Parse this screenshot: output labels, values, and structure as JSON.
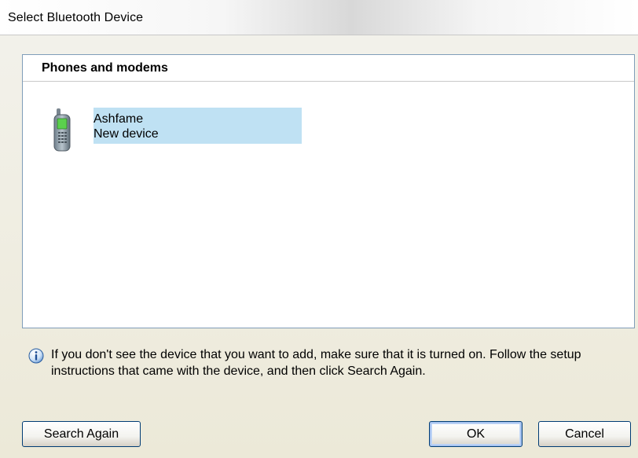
{
  "window": {
    "title": "Select Bluetooth Device"
  },
  "device_list": {
    "group_header": "Phones and modems",
    "devices": [
      {
        "name": "Ashfame",
        "status": "New device",
        "icon": "mobile-phone-icon",
        "selected": true
      }
    ]
  },
  "info": {
    "icon": "info-icon",
    "text": "If you don't see the device that you want to add, make sure that it is turned on. Follow the setup instructions that came with the device, and then click Search Again."
  },
  "buttons": {
    "search_again": "Search Again",
    "ok": "OK",
    "cancel": "Cancel"
  },
  "colors": {
    "selection": "#bfe1f3",
    "dialog_background": "#ece9d8",
    "panel_border": "#7f9db9"
  }
}
